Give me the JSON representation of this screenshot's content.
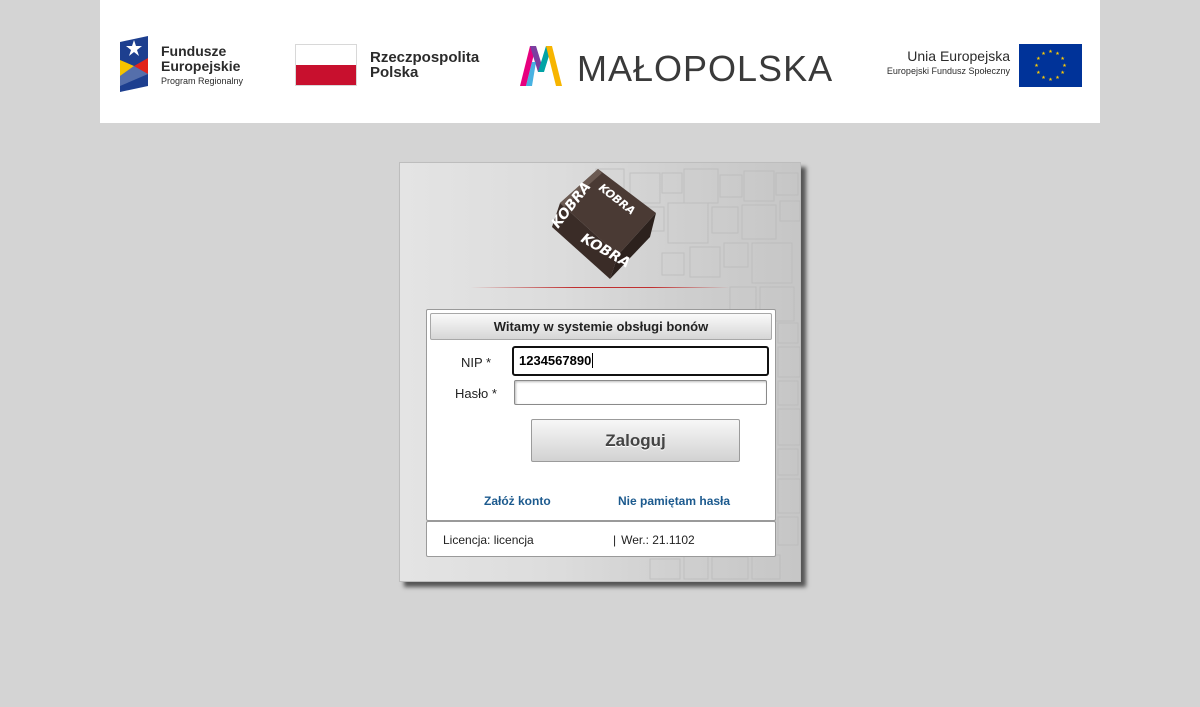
{
  "banner": {
    "fundusze": {
      "line1": "Fundusze",
      "line2": "Europejskie",
      "line3": "Program Regionalny"
    },
    "rzeczpospolita": {
      "line1": "Rzeczpospolita",
      "line2": "Polska"
    },
    "malopolska": "MAŁOPOLSKA",
    "unia": {
      "line1": "Unia Europejska",
      "line2": "Europejski Fundusz Społeczny"
    }
  },
  "login": {
    "logo_text": "KOBRA",
    "header": "Witamy w systemie obsługi bonów",
    "nip_label": "NIP *",
    "nip_value": "1234567890",
    "haslo_label": "Hasło *",
    "haslo_value": "",
    "submit_label": "Zaloguj",
    "create_account_link": "Załóż konto",
    "forgot_password_link": "Nie pamiętam hasła"
  },
  "footer": {
    "license": "Licencja: licencja",
    "separator": "|",
    "version": "Wer.: 21.1102"
  },
  "colors": {
    "page_bg": "#d4d4d4",
    "link": "#1c5a8e",
    "flag_red": "#c8102e",
    "eu_blue": "#003399",
    "eu_star": "#ffcc00"
  },
  "icons": {
    "fundusze_logo": "eu-funds-icon",
    "polska_flag": "poland-flag-icon",
    "malopolska_logo": "malopolska-m-icon",
    "eu_flag": "eu-flag-icon",
    "app_logo": "kobra-cube-icon"
  }
}
